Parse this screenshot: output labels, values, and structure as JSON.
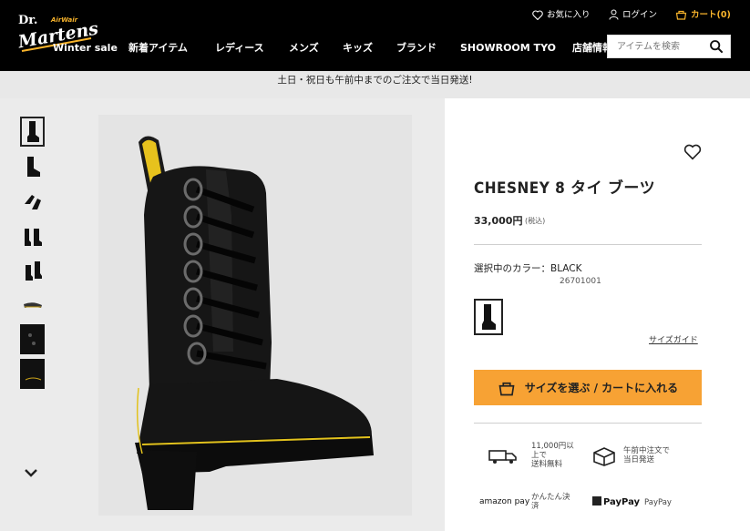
{
  "header": {
    "logo_text_1": "Dr.",
    "logo_text_2": "Martens",
    "logo_text_3": "AirWair",
    "nav": [
      {
        "label": "Winter sale"
      },
      {
        "label": "新着アイテム"
      },
      {
        "label": "レディース"
      },
      {
        "label": "メンズ"
      },
      {
        "label": "キッズ"
      },
      {
        "label": "ブランド"
      },
      {
        "label": "SHOWROOM TYO"
      },
      {
        "label": "店舗情報"
      }
    ],
    "favorites_label": "お気に入り",
    "login_label": "ログイン",
    "cart_label": "カート(0)",
    "search_placeholder": "アイテムを検索"
  },
  "banner": {
    "text": "土日・祝日も午前中までのご注文で当日発送!"
  },
  "product": {
    "title": "CHESNEY 8 タイ ブーツ",
    "price": "33,000円",
    "tax_note": "(税込)",
    "color_label": "選択中のカラー：BLACK",
    "sku": "26701001",
    "size_guide": "サイズガイド",
    "cta_label": "サイズを選ぶ / カートに入れる"
  },
  "perks": {
    "shipping_line1": "11,000円以",
    "shipping_line2": "上で",
    "shipping_line3": "送料無料",
    "sameday_line1": "午前中注文で",
    "sameday_line2": "当日発送",
    "amazon_label": "amazon pay",
    "amazon_line1": "かんたん決",
    "amazon_line2": "済",
    "paypay_logo": "PayPay",
    "paypay_label": "PayPay"
  },
  "colors": {
    "header_bg": "#000000",
    "cart_accent": "#f7b32b",
    "cta_bg": "#f7a234",
    "banner_bg": "#e8e8e8",
    "gallery_bg": "#ebebeb"
  },
  "icons": [
    "heart-icon",
    "user-icon",
    "cart-icon",
    "search-icon",
    "chevron-down-icon",
    "truck-icon",
    "box-icon",
    "bag-icon"
  ]
}
